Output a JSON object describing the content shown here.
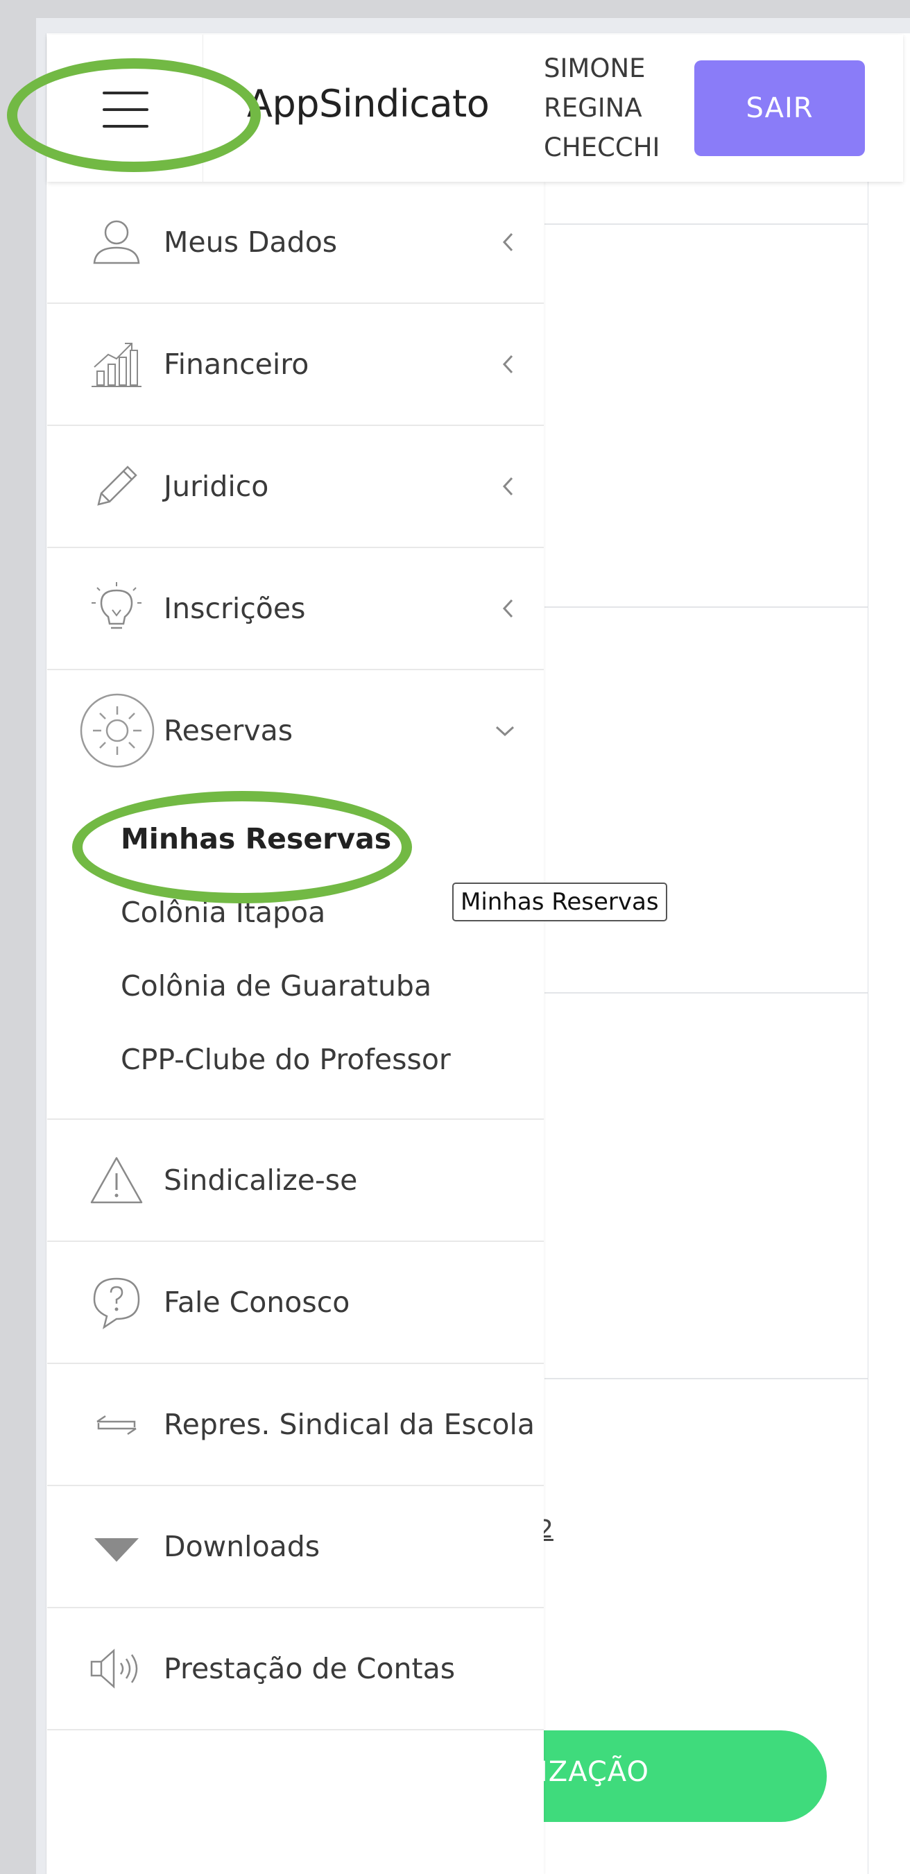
{
  "header": {
    "brand": "AppSindicato",
    "user_name_lines": [
      "SIMONE",
      "REGINA",
      "CHECCHI"
    ],
    "logout_label": "SAIR"
  },
  "sidebar": {
    "items": [
      {
        "label": "Meus Dados",
        "icon": "user-icon"
      },
      {
        "label": "Financeiro",
        "icon": "chart-growth-icon"
      },
      {
        "label": "Juridico",
        "icon": "pencil-icon"
      },
      {
        "label": "Inscrições",
        "icon": "lightbulb-icon"
      },
      {
        "label": "Reservas",
        "icon": "sun-icon",
        "expanded": true
      },
      {
        "label": "Sindicalize-se",
        "icon": "warning-icon"
      },
      {
        "label": "Fale Conosco",
        "icon": "question-bubble-icon"
      },
      {
        "label": "Repres. Sindical da Escola",
        "icon": "exchange-icon"
      },
      {
        "label": "Downloads",
        "icon": "triangle-down-icon"
      },
      {
        "label": "Prestação de Contas",
        "icon": "megaphone-icon"
      }
    ],
    "reservas_submenu": [
      "Minhas Reservas",
      "Colônia Itapoa",
      "Colônia de Guaratuba",
      "CPP-Clube do Professor"
    ]
  },
  "tooltip": "Minhas Reservas",
  "background": {
    "fragment": "2",
    "button_partial_label": "IZAÇÃO",
    "button_color": "#3fdb7c"
  },
  "colors": {
    "logout_button": "#8a7cf8",
    "annotation": "#72b944"
  }
}
